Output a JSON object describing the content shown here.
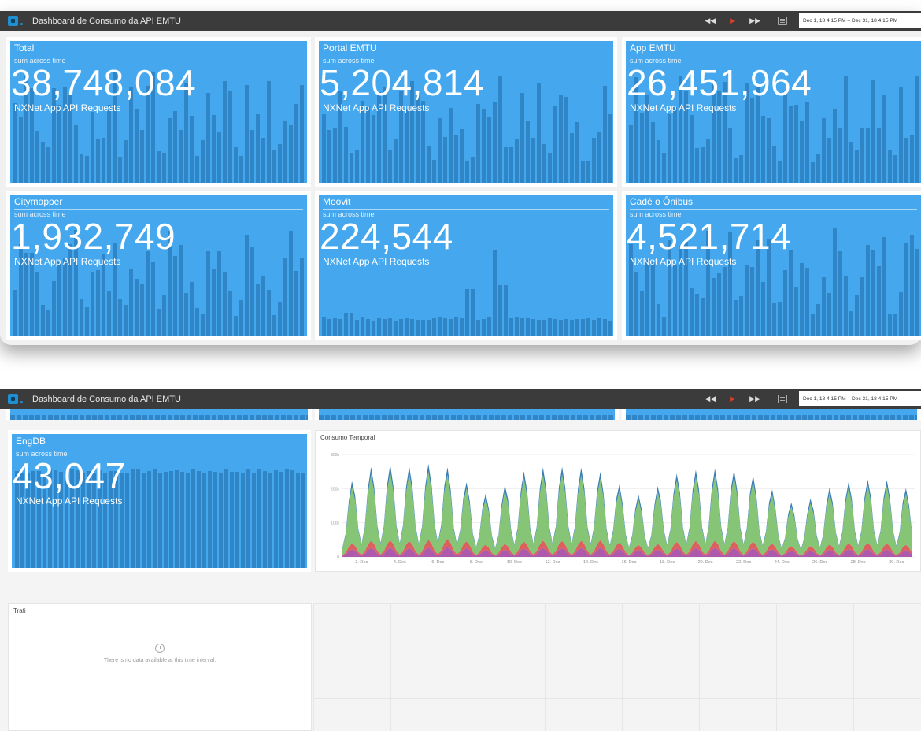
{
  "app": {
    "title": "Dashboard de Consumo da API EMTU",
    "time_range": "Dec 1, 18 4:15 PM – Dec 31, 18 4:15 PM",
    "controls": {
      "rewind": "◀◀",
      "play": "▶",
      "forward": "▶▶"
    }
  },
  "tiles": [
    {
      "title": "Total",
      "subtitle": "sum across time",
      "value": "38,748,084",
      "unit": "NXNet App API Requests"
    },
    {
      "title": "Portal EMTU",
      "subtitle": "sum across time",
      "value": "5,204,814",
      "unit": "NXNet App API Requests"
    },
    {
      "title": "App EMTU",
      "subtitle": "sum across time",
      "value": "26,451,964",
      "unit": "NXNet App API Requests"
    },
    {
      "title": "Citymapper",
      "subtitle": "sum across time",
      "value": "1,932,749",
      "unit": "NXNet App API Requests"
    },
    {
      "title": "Moovit",
      "subtitle": "sum across time",
      "value": "224,544",
      "unit": "NXNet App API Requests"
    },
    {
      "title": "Cadê o Ônibus",
      "subtitle": "sum across time",
      "value": "4,521,714",
      "unit": "NXNet App API Requests"
    }
  ],
  "engdb": {
    "title": "EngDB",
    "subtitle": "sum across time",
    "value": "43,047",
    "unit": "NXNet App API Requests"
  },
  "consumo": {
    "title": "Consumo Temporal"
  },
  "trafi": {
    "title": "Trafi",
    "empty_message": "There is no data available at this time interval."
  },
  "chart_data": {
    "type": "area",
    "title": "Consumo Temporal",
    "y_ticks": [
      "0",
      "100k",
      "200k",
      "300k"
    ],
    "ylim": [
      0,
      300000
    ],
    "x_ticks": [
      "2. Dec",
      "4. Dec",
      "6. Dec",
      "8. Dec",
      "10. Dec",
      "12. Dec",
      "14. Dec",
      "16. Dec",
      "18. Dec",
      "20. Dec",
      "22. Dec",
      "24. Dec",
      "26. Dec",
      "28. Dec",
      "30. Dec"
    ],
    "x": [
      "1 Dec",
      "2 Dec",
      "3 Dec",
      "4 Dec",
      "5 Dec",
      "6 Dec",
      "7 Dec",
      "8 Dec",
      "9 Dec",
      "10 Dec",
      "11 Dec",
      "12 Dec",
      "13 Dec",
      "14 Dec",
      "15 Dec",
      "16 Dec",
      "17 Dec",
      "18 Dec",
      "19 Dec",
      "20 Dec",
      "21 Dec",
      "22 Dec",
      "23 Dec",
      "24 Dec",
      "25 Dec",
      "26 Dec",
      "27 Dec",
      "28 Dec",
      "29 Dec",
      "30 Dec",
      "31 Dec"
    ],
    "stacked": true,
    "series": [
      {
        "color": "#a64ca6",
        "values": [
          20000,
          25000,
          28000,
          27000,
          26000,
          30000,
          29000,
          22000,
          19000,
          24000,
          26000,
          27000,
          25000,
          28000,
          27000,
          21000,
          19000,
          24000,
          26000,
          27000,
          27000,
          26000,
          25000,
          20000,
          17000,
          20000,
          22000,
          24000,
          23000,
          22000,
          18000
        ]
      },
      {
        "color": "#d9534f",
        "values": [
          15000,
          20000,
          22000,
          21000,
          20000,
          24000,
          23000,
          18000,
          14000,
          20000,
          21000,
          22000,
          20000,
          22000,
          21000,
          16000,
          15000,
          19000,
          20000,
          21000,
          21000,
          20000,
          19000,
          15000,
          12000,
          15000,
          17000,
          18000,
          18000,
          17000,
          14000
        ]
      },
      {
        "color": "#7cbf6a",
        "values": [
          140000,
          190000,
          200000,
          200000,
          195000,
          205000,
          170000,
          140000,
          130000,
          180000,
          190000,
          195000,
          195000,
          190000,
          170000,
          135000,
          130000,
          175000,
          185000,
          190000,
          190000,
          185000,
          165000,
          120000,
          110000,
          140000,
          160000,
          165000,
          170000,
          165000,
          135000
        ]
      },
      {
        "color": "#2a74ad",
        "values": [
          15000,
          20000,
          22000,
          21000,
          21000,
          24000,
          20000,
          15000,
          14000,
          20000,
          21000,
          22000,
          22000,
          21000,
          19000,
          15000,
          14000,
          19000,
          20000,
          21000,
          21000,
          20000,
          18000,
          13000,
          12000,
          16000,
          17000,
          18000,
          18000,
          17000,
          15000
        ]
      }
    ],
    "grid": true,
    "legend": "none"
  }
}
